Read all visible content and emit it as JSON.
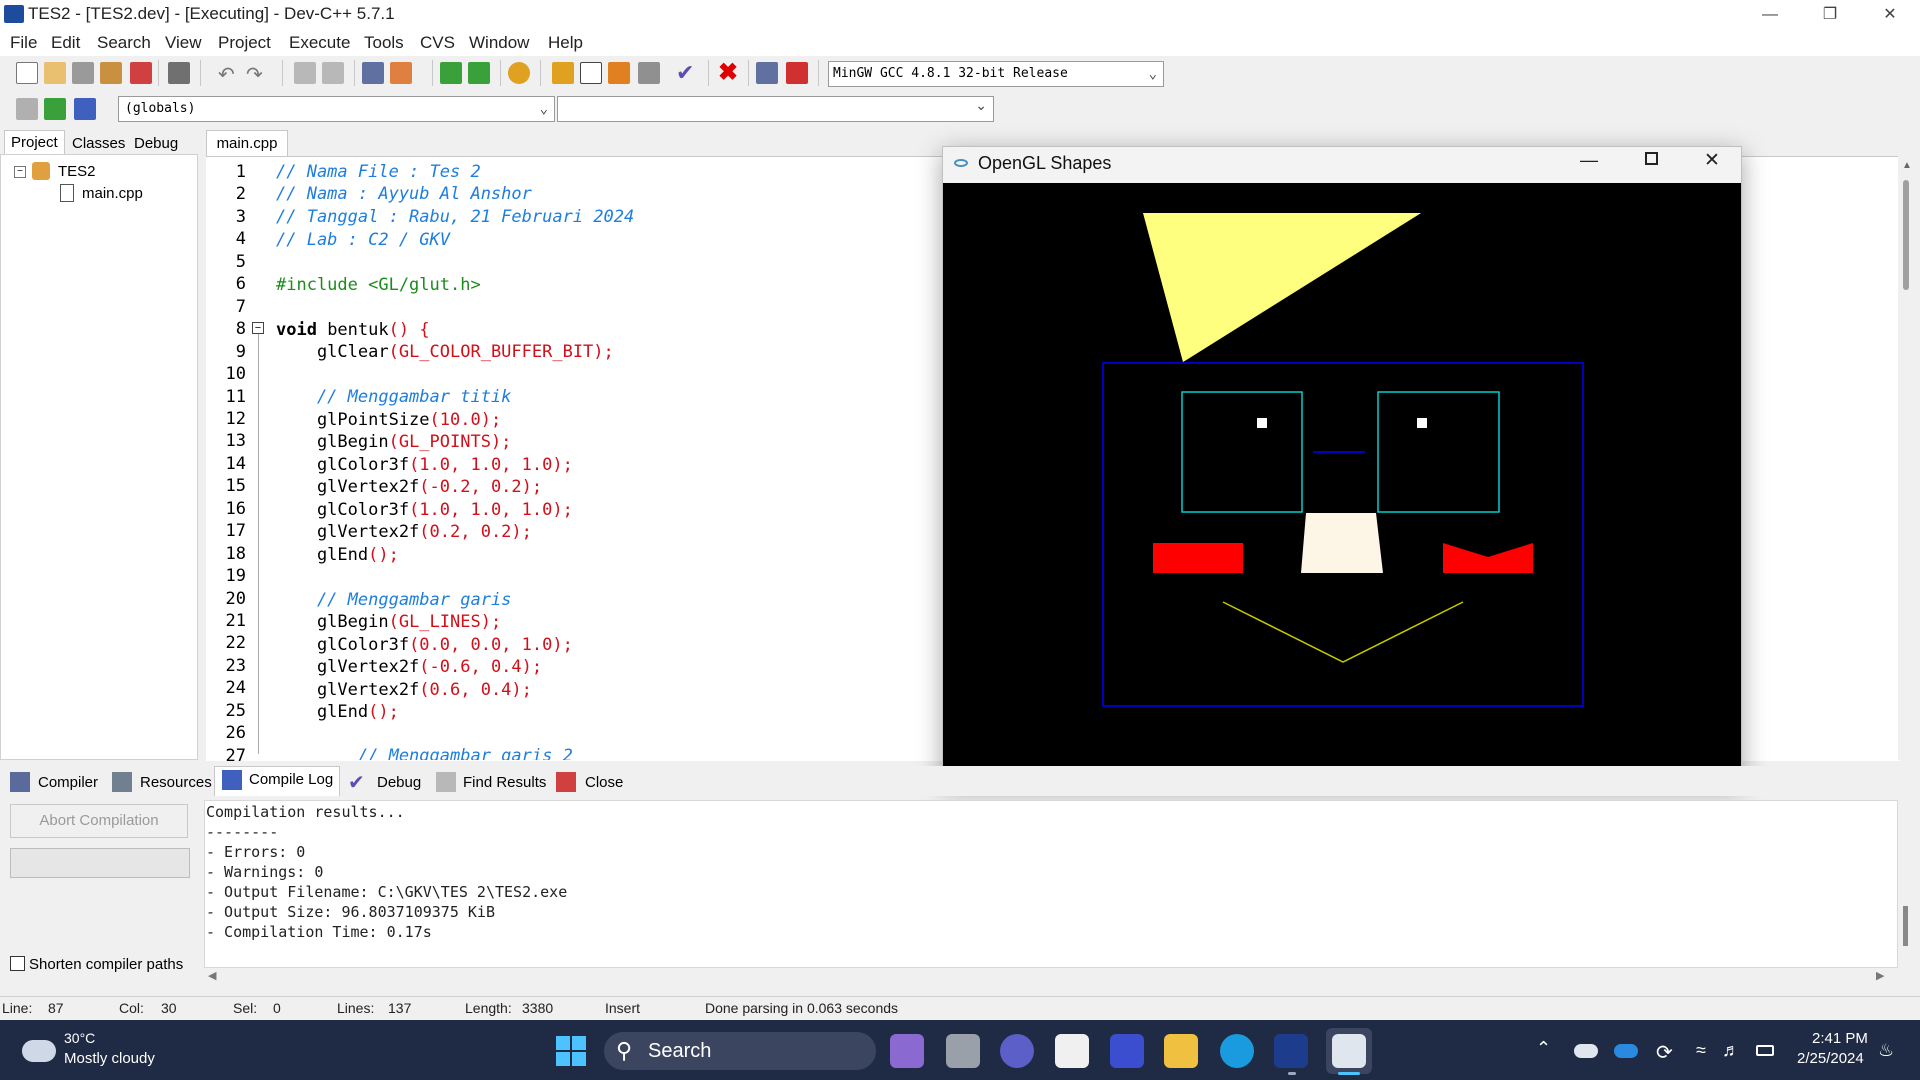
{
  "window": {
    "title": "TES2 - [TES2.dev] - [Executing] - Dev-C++ 5.7.1"
  },
  "menu": [
    "File",
    "Edit",
    "Search",
    "View",
    "Project",
    "Execute",
    "Tools",
    "CVS",
    "Window",
    "Help"
  ],
  "toolbar": {
    "compiler": "MinGW GCC 4.8.1 32-bit Release",
    "scope": "(globals)"
  },
  "left_tabs": [
    "Project",
    "Classes",
    "Debug"
  ],
  "project_tree": {
    "root": "TES2",
    "file": "main.cpp"
  },
  "editor": {
    "tab": "main.cpp",
    "line_numbers": [
      "1",
      "2",
      "3",
      "4",
      "5",
      "6",
      "7",
      "8",
      "9",
      "10",
      "11",
      "12",
      "13",
      "14",
      "15",
      "16",
      "17",
      "18",
      "19",
      "20",
      "21",
      "22",
      "23",
      "24",
      "25",
      "26",
      "27"
    ]
  },
  "code": {
    "l1": "// Nama File : Tes 2",
    "l2": "// Nama : Ayyub Al Anshor",
    "l3": "// Tanggal : Rabu, 21 Februari 2024",
    "l4": "// Lab : C2 / GKV",
    "l6": "#include <GL/glut.h>",
    "l8_kw": "void",
    "l8_rest": " bentuk",
    "l8_p": "() {",
    "l9_a": "    glClear",
    "l9_b": "(GL_COLOR_BUFFER_BIT);",
    "l11": "    // Menggambar titik",
    "l12_a": "    glPointSize",
    "l12_b": "(",
    "l12_n": "10.0",
    "l12_c": ");",
    "l13_a": "    glBegin",
    "l13_b": "(GL_POINTS);",
    "l14_a": "    glColor3f",
    "l14_b": "(1.0, 1.0, 1.0);",
    "l15_a": "    glVertex2f",
    "l15_b": "(-0.2, 0.2);",
    "l16_a": "    glColor3f",
    "l16_b": "(1.0, 1.0, 1.0);",
    "l17_a": "    glVertex2f",
    "l17_b": "(0.2, 0.2);",
    "l18_a": "    glEnd",
    "l18_b": "();",
    "l20": "    // Menggambar garis",
    "l21_a": "    glBegin",
    "l21_b": "(GL_LINES);",
    "l22_a": "    glColor3f",
    "l22_b": "(0.0, 0.0, 1.0);",
    "l23_a": "    glVertex2f",
    "l23_b": "(-0.6, 0.4);",
    "l24_a": "    glVertex2f",
    "l24_b": "(0.6, 0.4);",
    "l25_a": "    glEnd",
    "l25_b": "();",
    "l27": "        // Menggambar garis 2"
  },
  "bottom_tabs": [
    "Compiler",
    "Resources",
    "Compile Log",
    "Debug",
    "Find Results",
    "Close"
  ],
  "abort_label": "Abort Compilation",
  "shorten_label": "Shorten compiler paths",
  "log": [
    "Compilation results...",
    "--------",
    "- Errors: 0",
    "- Warnings: 0",
    "- Output Filename: C:\\GKV\\TES 2\\TES2.exe",
    "- Output Size: 96.8037109375 KiB",
    "- Compilation Time: 0.17s"
  ],
  "status": {
    "line_label": "Line:",
    "line": "87",
    "col_label": "Col:",
    "col": "30",
    "sel_label": "Sel:",
    "sel": "0",
    "lines_label": "Lines:",
    "lines": "137",
    "length_label": "Length:",
    "length": "3380",
    "mode": "Insert",
    "message": "Done parsing in 0.063 seconds"
  },
  "gl_window": {
    "title": "OpenGL Shapes"
  },
  "taskbar": {
    "weather_temp": "30°C",
    "weather_desc": "Mostly cloudy",
    "search": "Search",
    "time": "2:41 PM",
    "date": "2/25/2024"
  },
  "colors": {
    "accent": "#1e7ee0",
    "keyword_red": "#d0101a",
    "preproc_green": "#1c8c1c"
  }
}
